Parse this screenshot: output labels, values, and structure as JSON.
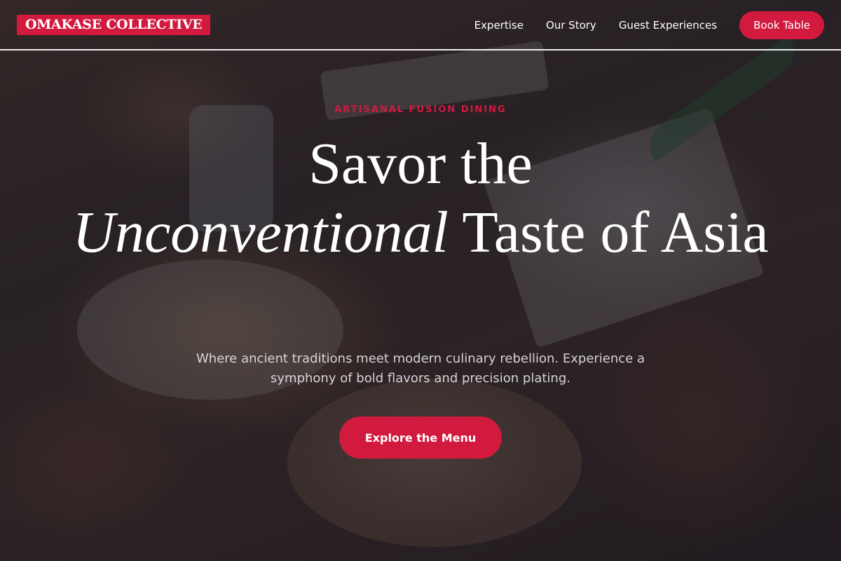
{
  "brand": {
    "name": "OMAKASE COLLECTIVE",
    "accent_color": "#d2193e"
  },
  "nav": {
    "links": [
      "Expertise",
      "Our Story",
      "Guest Experiences"
    ],
    "book_label": "Book Table"
  },
  "hero": {
    "eyebrow": "ARTISANAL FUSION DINING",
    "headline_part1": "Savor the",
    "headline_italic": "Unconventional",
    "headline_part2": "Taste of Asia",
    "subtext": "Where ancient traditions meet modern culinary rebellion. Experience a symphony of bold flavors and precision plating.",
    "cta_label": "Explore the Menu"
  }
}
